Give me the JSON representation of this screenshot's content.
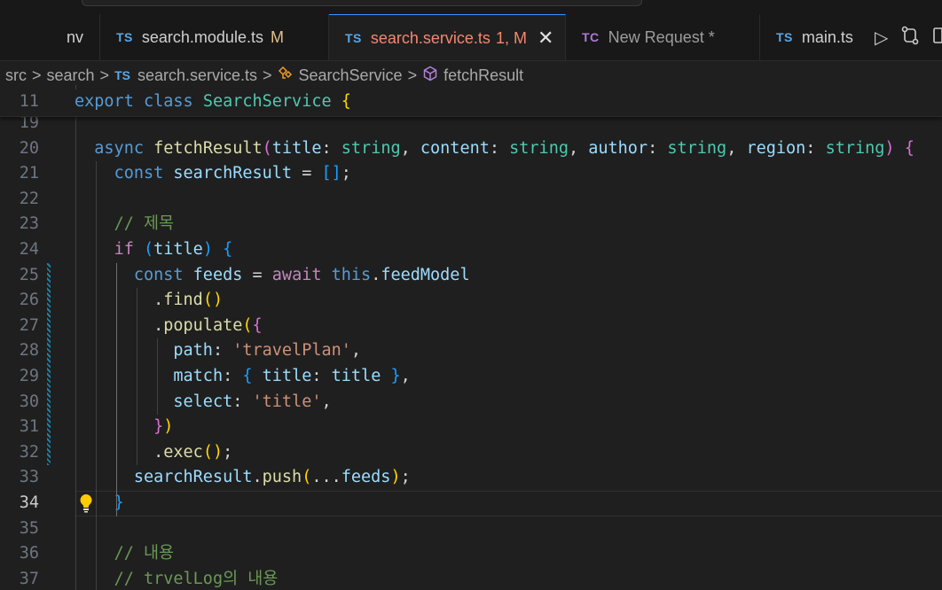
{
  "tabs": [
    {
      "prefix": "",
      "name": "nv",
      "status": ""
    },
    {
      "prefix": "TS",
      "name": "search.module.ts",
      "status": "M"
    },
    {
      "prefix": "TS",
      "name": "search.service.ts",
      "status": "1, M",
      "close": "✕"
    },
    {
      "prefix": "TC",
      "name": "New Request *",
      "status": ""
    },
    {
      "prefix": "TS",
      "name": "main.ts",
      "status": ""
    }
  ],
  "tab_actions": [
    "run-icon",
    "compare-changes-icon",
    "split-editor-icon"
  ],
  "breadcrumb": {
    "folder1": "src",
    "folder2": "search",
    "file_prefix": "TS",
    "file": "search.service.ts",
    "class": "SearchService",
    "method": "fetchResult",
    "separator": ">"
  },
  "editor": {
    "sticky": {
      "ln": "11",
      "parts": [
        [
          "kw",
          "export"
        ],
        [
          "tx",
          " "
        ],
        [
          "kw",
          "class"
        ],
        [
          "tx",
          " "
        ],
        [
          "ty",
          "SearchService"
        ],
        [
          "tx",
          " "
        ],
        [
          "p1",
          "{"
        ]
      ]
    },
    "lines": [
      {
        "ln": "19",
        "parts": []
      },
      {
        "ln": "20",
        "parts": [
          [
            "tx",
            "  "
          ],
          [
            "kw",
            "async"
          ],
          [
            "tx",
            " "
          ],
          [
            "fn",
            "fetchResult"
          ],
          [
            "p2",
            "("
          ],
          [
            "var",
            "title"
          ],
          [
            "tx",
            ": "
          ],
          [
            "ty",
            "string"
          ],
          [
            "tx",
            ", "
          ],
          [
            "var",
            "content"
          ],
          [
            "tx",
            ": "
          ],
          [
            "ty",
            "string"
          ],
          [
            "tx",
            ", "
          ],
          [
            "var",
            "author"
          ],
          [
            "tx",
            ": "
          ],
          [
            "ty",
            "string"
          ],
          [
            "tx",
            ", "
          ],
          [
            "var",
            "region"
          ],
          [
            "tx",
            ": "
          ],
          [
            "ty",
            "string"
          ],
          [
            "p2",
            ")"
          ],
          [
            "tx",
            " "
          ],
          [
            "p2",
            "{"
          ]
        ]
      },
      {
        "ln": "21",
        "parts": [
          [
            "tx",
            "    "
          ],
          [
            "kw",
            "const"
          ],
          [
            "tx",
            " "
          ],
          [
            "var",
            "searchResult"
          ],
          [
            "tx",
            " = "
          ],
          [
            "p3",
            "[]"
          ],
          [
            "tx",
            ";"
          ]
        ]
      },
      {
        "ln": "22",
        "parts": []
      },
      {
        "ln": "23",
        "parts": [
          [
            "tx",
            "    "
          ],
          [
            "cm",
            "// 제목"
          ]
        ]
      },
      {
        "ln": "24",
        "parts": [
          [
            "tx",
            "    "
          ],
          [
            "ctl",
            "if"
          ],
          [
            "tx",
            " "
          ],
          [
            "p3",
            "("
          ],
          [
            "var",
            "title"
          ],
          [
            "p3",
            ")"
          ],
          [
            "tx",
            " "
          ],
          [
            "p3",
            "{"
          ]
        ]
      },
      {
        "ln": "25",
        "parts": [
          [
            "tx",
            "      "
          ],
          [
            "kw",
            "const"
          ],
          [
            "tx",
            " "
          ],
          [
            "var",
            "feeds"
          ],
          [
            "tx",
            " = "
          ],
          [
            "ctl",
            "await"
          ],
          [
            "tx",
            " "
          ],
          [
            "kw",
            "this"
          ],
          [
            "tx",
            "."
          ],
          [
            "var",
            "feedModel"
          ]
        ]
      },
      {
        "ln": "26",
        "parts": [
          [
            "tx",
            "        ."
          ],
          [
            "fn",
            "find"
          ],
          [
            "p1",
            "()"
          ]
        ]
      },
      {
        "ln": "27",
        "parts": [
          [
            "tx",
            "        ."
          ],
          [
            "fn",
            "populate"
          ],
          [
            "p1",
            "("
          ],
          [
            "p2",
            "{"
          ]
        ]
      },
      {
        "ln": "28",
        "parts": [
          [
            "tx",
            "          "
          ],
          [
            "var",
            "path"
          ],
          [
            "tx",
            ": "
          ],
          [
            "str",
            "'travelPlan'"
          ],
          [
            "tx",
            ","
          ]
        ]
      },
      {
        "ln": "29",
        "parts": [
          [
            "tx",
            "          "
          ],
          [
            "var",
            "match"
          ],
          [
            "tx",
            ": "
          ],
          [
            "p3",
            "{"
          ],
          [
            "tx",
            " "
          ],
          [
            "var",
            "title"
          ],
          [
            "tx",
            ": "
          ],
          [
            "var",
            "title"
          ],
          [
            "tx",
            " "
          ],
          [
            "p3",
            "}"
          ],
          [
            "tx",
            ","
          ]
        ]
      },
      {
        "ln": "30",
        "parts": [
          [
            "tx",
            "          "
          ],
          [
            "var",
            "select"
          ],
          [
            "tx",
            ": "
          ],
          [
            "str",
            "'title'"
          ],
          [
            "tx",
            ","
          ]
        ]
      },
      {
        "ln": "31",
        "parts": [
          [
            "tx",
            "        "
          ],
          [
            "p2",
            "}"
          ],
          [
            "p1",
            ")"
          ]
        ]
      },
      {
        "ln": "32",
        "parts": [
          [
            "tx",
            "        ."
          ],
          [
            "fn",
            "exec"
          ],
          [
            "p1",
            "()"
          ],
          [
            "tx",
            ";"
          ]
        ]
      },
      {
        "ln": "33",
        "parts": [
          [
            "tx",
            "      "
          ],
          [
            "var",
            "searchResult"
          ],
          [
            "tx",
            "."
          ],
          [
            "fn",
            "push"
          ],
          [
            "p1",
            "("
          ],
          [
            "tx",
            "..."
          ],
          [
            "var",
            "feeds"
          ],
          [
            "p1",
            ")"
          ],
          [
            "tx",
            ";"
          ]
        ]
      },
      {
        "ln": "34",
        "parts": [
          [
            "tx",
            "    "
          ],
          [
            "p3",
            "}"
          ]
        ]
      },
      {
        "ln": "35",
        "parts": []
      },
      {
        "ln": "36",
        "parts": [
          [
            "tx",
            "    "
          ],
          [
            "cm",
            "// 내용"
          ]
        ]
      },
      {
        "ln": "37",
        "parts": [
          [
            "tx",
            "    "
          ],
          [
            "cm",
            "// trvelLog의 내용"
          ]
        ]
      }
    ],
    "current_line": "34"
  },
  "colors": {
    "accent": "#3794ff",
    "modified_tab": "#f48771",
    "lightbulb": "#ffcc00"
  }
}
